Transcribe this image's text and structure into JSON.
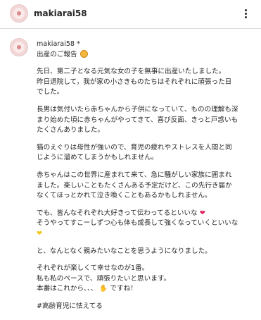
{
  "header": {
    "username": "makiarai58"
  },
  "post": {
    "username": "makiarai58",
    "verified_mark": "*",
    "paragraphs": [
      [
        "出産のご報告"
      ],
      [
        "先日、第二子となる元気な女の子を無事に出産いたしました。",
        "昨日退院して，我が家の小さきものたちはそれぞれに頑張った日",
        "でした。"
      ],
      [
        "長男は気付いたら赤ちゃんから子供になっていて、ものの理解も深",
        "まり始めた頃に赤ちゃんがやってきて、喜び反面、きっと戸惑いも",
        "たくさんありました。"
      ],
      [
        "猫のえぐりは母性が強いので、育児の疲れやストレスを人間と同",
        "じように溜めてしまうかもしれません。"
      ],
      [
        "赤ちゃんはこの世界に産まれて来て、急に騒がしい家族に囲まれ",
        "ました。楽しいこともたくさんある予定だけど、この先行き届か",
        "なくてほっとかれて泣き喚くこともあるかもしれません。"
      ],
      [
        "でも、皆んなそれぞれ大好きって伝わってるといいな",
        "そうやってすこーしずつ心も体も成長して強くなっていくといいな"
      ],
      [
        "と、なんとなく親みたいなことを思うようになりました。"
      ],
      [
        "それぞれが楽しくて幸せなのが1番。",
        "私も私のペースで、頑張りたいと思います。",
        "本番はこれから、、、",
        "ですね！"
      ]
    ],
    "hashtag": "#高齢育児に怯えてる"
  },
  "emojis": {
    "report": "face-emoji",
    "heart": "red-heart-emoji",
    "yellow_heart": "yellow-heart-emoji",
    "muscle": "flexed-biceps-emoji"
  },
  "colors": {
    "heart": "#e0245e",
    "yellow_heart": "#f5c518",
    "face": "#f4b63f",
    "hashtag": "#00376b"
  }
}
